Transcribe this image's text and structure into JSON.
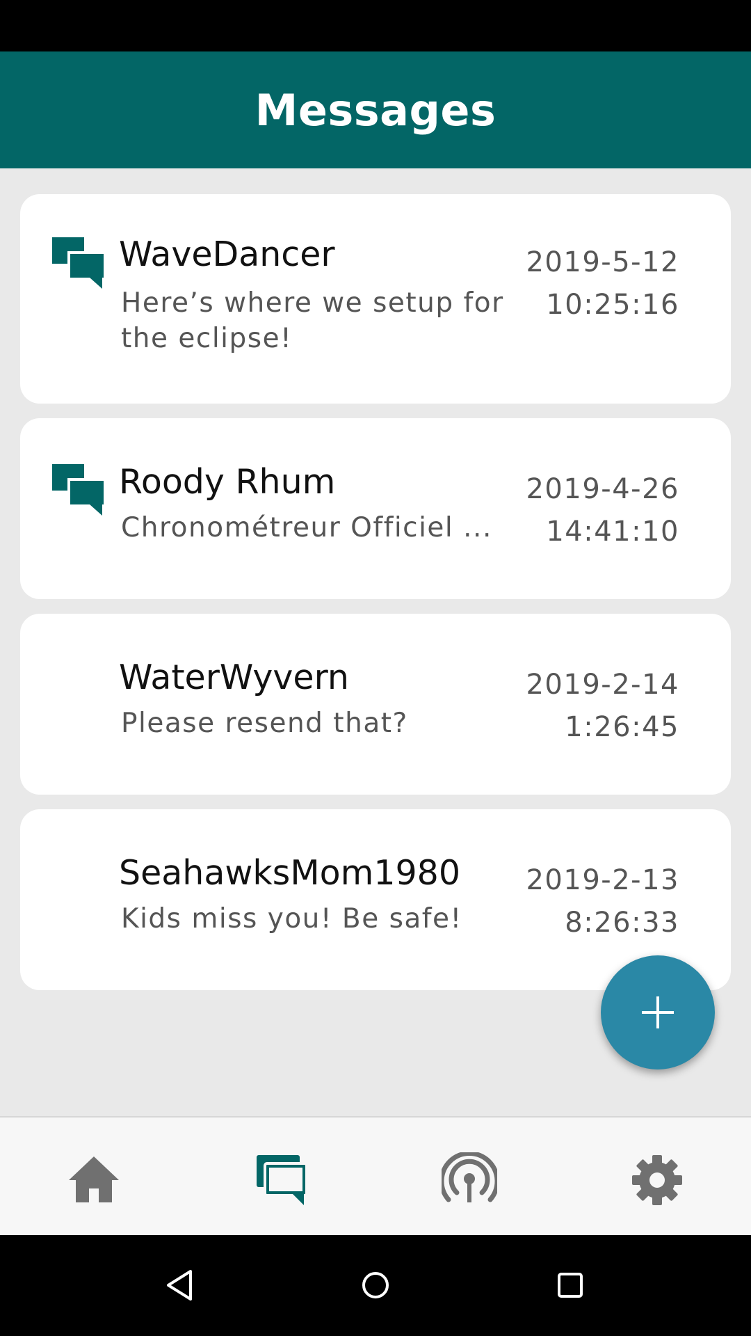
{
  "header": {
    "title": "Messages"
  },
  "messages": [
    {
      "sender": "WaveDancer",
      "preview": "Here’s where we setup for the eclipse!",
      "date": "2019-5-12",
      "time": "10:25:16",
      "icon": "chat-bubbles-icon"
    },
    {
      "sender": "Roody Rhum",
      "preview": "Chronométreur Officiel ...",
      "date": "2019-4-26",
      "time": "14:41:10",
      "icon": "chat-bubbles-icon"
    },
    {
      "sender": "WaterWyvern",
      "preview": "Please resend that?",
      "date": "2019-2-14",
      "time": "1:26:45"
    },
    {
      "sender": "SeahawksMom1980",
      "preview": "Kids miss you! Be safe!",
      "date": "2019-2-13",
      "time": "8:26:33"
    }
  ],
  "fab": {
    "icon": "plus-icon"
  },
  "bottom_nav": {
    "items": [
      {
        "icon": "home-icon",
        "active": false
      },
      {
        "icon": "chat-bubbles-icon",
        "active": true
      },
      {
        "icon": "broadcast-icon",
        "active": false
      },
      {
        "icon": "gear-icon",
        "active": false
      }
    ]
  },
  "system_nav": {
    "items": [
      "back-icon",
      "home-circle-icon",
      "recents-square-icon"
    ]
  },
  "colors": {
    "header_bg": "#036666",
    "accent": "#036666",
    "fab": "#2a88a6",
    "background": "#e9e9e9",
    "nav_inactive": "#707070"
  }
}
